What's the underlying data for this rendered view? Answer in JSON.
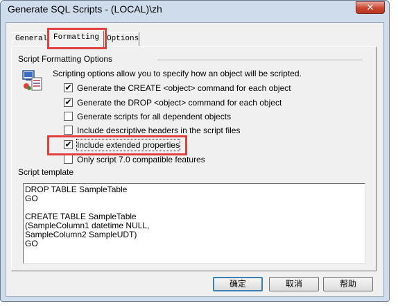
{
  "window": {
    "title": "Generate SQL Scripts - (LOCAL)\\zh",
    "close_glyph": "✕"
  },
  "tabs": [
    {
      "label": "General"
    },
    {
      "label": "Formatting",
      "active": true
    },
    {
      "label": "Options"
    }
  ],
  "formatting": {
    "section_title": "Script Formatting Options",
    "description": "Scripting options allow you to specify how an object will be scripted.",
    "icon": "script-document-icon",
    "options": [
      {
        "label": "Generate the CREATE <object> command for each object",
        "checked": true
      },
      {
        "label": "Generate the DROP <object> command for each object",
        "checked": true
      },
      {
        "label": "Generate scripts for all dependent objects",
        "checked": false
      },
      {
        "label": "Include descriptive headers in the script files",
        "checked": false
      },
      {
        "label": "Include extended properties",
        "checked": true
      },
      {
        "label": "Only script 7.0 compatible features",
        "checked": false
      }
    ],
    "check_glyph": "✔"
  },
  "template": {
    "label": "Script template",
    "lines": [
      "DROP TABLE SampleTable",
      "GO",
      "",
      "CREATE TABLE SampleTable",
      "(SampleColumn1 datetime NULL,",
      "SampleColumn2 SampleUDT)",
      "GO"
    ]
  },
  "buttons": {
    "ok": "确定",
    "cancel": "取消",
    "help": "帮助"
  },
  "highlight_color": "#e0413f"
}
